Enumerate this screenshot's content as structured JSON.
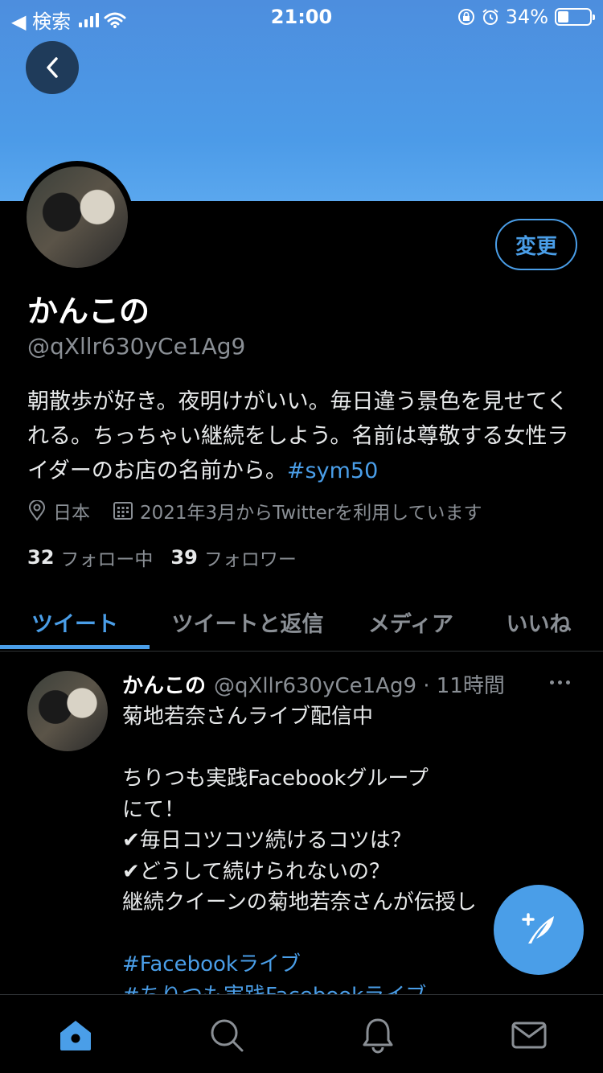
{
  "status_bar": {
    "back_app": "◀ 検索",
    "time": "21:00",
    "battery": "34%",
    "battery_level": 0.34
  },
  "profile": {
    "edit_button": "変更",
    "name": "かんこの",
    "handle": "@qXllr630yCe1Ag9",
    "bio_text": "朝散歩が好き。夜明けがいい。毎日違う景色を見せてくれる。ちっちゃい継続をしよう。名前は尊敬する女性ライダーのお店の名前から。",
    "bio_hashtag": "#sym50",
    "location": "日本",
    "joined": "2021年3月からTwitterを利用しています",
    "following_count": "32",
    "following_label": "フォロー中",
    "followers_count": "39",
    "followers_label": "フォロワー"
  },
  "tabs": [
    {
      "label": "ツイート",
      "active": true
    },
    {
      "label": "ツイートと返信",
      "active": false
    },
    {
      "label": "メディア",
      "active": false
    },
    {
      "label": "いいね",
      "active": false
    }
  ],
  "tweet": {
    "author": "かんこの",
    "handle_time": "@qXllr630yCe1Ag9 · 11時間",
    "body_text": "菊地若奈さんライブ配信中\n\nちりつも実践Facebookグループ\nにて！\n✔毎日コツコツ続けるコツは？\n✔どうして続けられないの？\n継続クイーンの菊地若奈さんが伝授し\n\n",
    "hashtag1": "#Facebookライブ",
    "hashtag2": "#ちりつも実践Facebookライブ"
  },
  "colors": {
    "accent": "#4a9ee8",
    "banner": "#4c9be8",
    "muted": "#8a8f95",
    "background": "#000000"
  },
  "bottom_nav": [
    "home-icon",
    "search-icon",
    "notifications-icon",
    "messages-icon"
  ]
}
